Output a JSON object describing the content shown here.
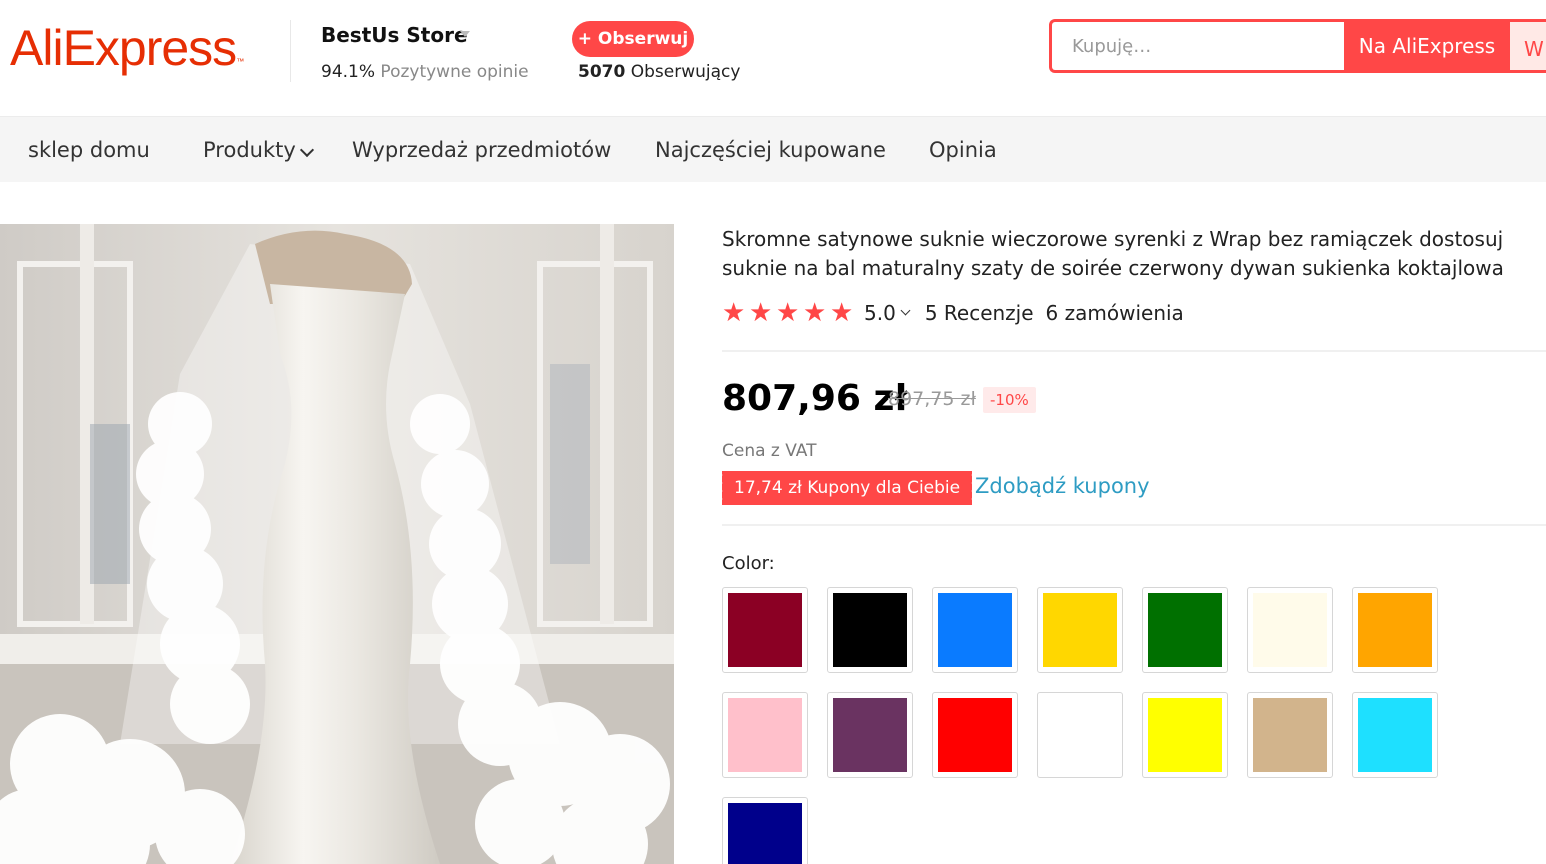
{
  "header": {
    "logo_text": "AliExpress",
    "logo_tm": "™",
    "store_name": "BestUs Store",
    "rating_value": "94.1%",
    "rating_label": "Pozytywne opinie",
    "follow_label": "+ Obserwuj",
    "followers_count": "5070",
    "followers_label": "Obserwujący",
    "search_placeholder": "Kupuję…",
    "search_button": "Na AliExpress",
    "search_button2": "W sklepie"
  },
  "nav": {
    "items": [
      "sklep domu",
      "Produkty",
      "Wyprzedaż przedmiotów",
      "Najczęściej kupowane",
      "Opinia"
    ]
  },
  "product": {
    "title": "Skromne satynowe suknie wieczorowe syrenki z Wrap bez ramiączek dostosuj suknie na bal maturalny szaty de soirée czerwony dywan sukienka koktajlowa",
    "rating": "5.0",
    "reviews": "5 Recenzje",
    "orders": "6 zamówienia",
    "price": "807,96 zł",
    "old_price": "897,75 zł",
    "discount": "-10%",
    "vat": "Cena z VAT",
    "coupon": "17,74 zł Kupony dla Ciebie",
    "get_coupons": "Zdobądź kupony",
    "color_label": "Color:",
    "colors": [
      "#8b0024",
      "#000000",
      "#0a7bff",
      "#ffd700",
      "#007000",
      "#fffbea",
      "#ffa500",
      "#ffc0cb",
      "#6a3361",
      "#ff0000",
      "#ffffff",
      "#ffff00",
      "#d2b48c",
      "#1ee0ff",
      "#00008b"
    ]
  }
}
